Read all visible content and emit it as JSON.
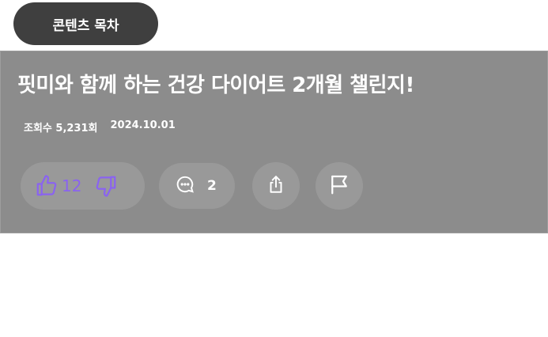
{
  "toc_button": {
    "label": "콘텐츠 목차"
  },
  "post": {
    "title": "핏미와 함께 하는 건강 다이어트 2개월 챌린지!",
    "views": "조회수 5,231회",
    "date": "2024.10.01"
  },
  "actions": {
    "like_count": "12",
    "comment_count": "2",
    "icons": {
      "like": "thumbs-up-icon",
      "dislike": "thumbs-down-icon",
      "comment": "comment-icon",
      "share": "share-icon",
      "report": "flag-icon"
    }
  },
  "colors": {
    "toc_background": "#3f3f3f",
    "card_background": "#8c8c8c",
    "button_background": "#999999",
    "vote_accent": "#8a63f0",
    "text": "#ffffff"
  }
}
